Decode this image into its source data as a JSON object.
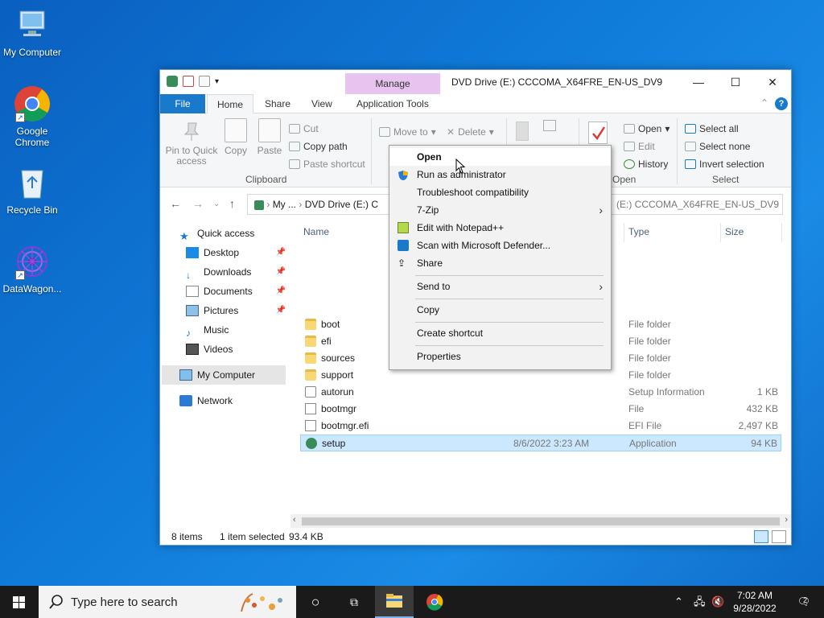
{
  "desktop": {
    "icons": [
      {
        "label": "My Computer"
      },
      {
        "label": "Google Chrome"
      },
      {
        "label": "Recycle Bin"
      },
      {
        "label": "DataWagon..."
      }
    ]
  },
  "window": {
    "manage_tab": "Manage",
    "title": "DVD Drive (E:) CCCOMA_X64FRE_EN-US_DV9",
    "tabs": {
      "file": "File",
      "home": "Home",
      "share": "Share",
      "view": "View",
      "app_tools": "Application Tools"
    },
    "ribbon": {
      "pin_quick_access": "Pin to Quick access",
      "copy": "Copy",
      "paste": "Paste",
      "cut": "Cut",
      "copy_path": "Copy path",
      "paste_shortcut": "Paste shortcut",
      "clipboard_group": "Clipboard",
      "move_to": "Move to",
      "delete": "Delete",
      "open_dropdown": "Open",
      "edit": "Edit",
      "history": "History",
      "open_group": "Open",
      "select_all": "Select all",
      "select_none": "Select none",
      "invert_selection": "Invert selection",
      "select_group": "Select"
    },
    "address": {
      "crumb1": "My ...",
      "crumb2": "DVD Drive (E:) C"
    },
    "search": {
      "text": "(E:) CCCOMA_X64FRE_EN-US_DV9"
    },
    "nav": {
      "quick_access": "Quick access",
      "desktop": "Desktop",
      "downloads": "Downloads",
      "documents": "Documents",
      "pictures": "Pictures",
      "music": "Music",
      "videos": "Videos",
      "my_computer": "My Computer",
      "network": "Network"
    },
    "columns": {
      "name": "Name",
      "type": "Type",
      "size": "Size"
    },
    "files": [
      {
        "name": "boot",
        "date": "",
        "type": "File folder",
        "size": ""
      },
      {
        "name": "efi",
        "date": "",
        "type": "File folder",
        "size": ""
      },
      {
        "name": "sources",
        "date": "",
        "type": "File folder",
        "size": ""
      },
      {
        "name": "support",
        "date": "",
        "type": "File folder",
        "size": ""
      },
      {
        "name": "autorun",
        "date": "",
        "type": "Setup Information",
        "size": "1 KB"
      },
      {
        "name": "bootmgr",
        "date": "",
        "type": "File",
        "size": "432 KB"
      },
      {
        "name": "bootmgr.efi",
        "date": "",
        "type": "EFI File",
        "size": "2,497 KB"
      },
      {
        "name": "setup",
        "date": "8/6/2022 3:23 AM",
        "type": "Application",
        "size": "94 KB"
      }
    ],
    "status": {
      "items": "8 items",
      "selected": "1 item selected",
      "size": "93.4 KB"
    }
  },
  "context_menu": {
    "open": "Open",
    "run_as_admin": "Run as administrator",
    "troubleshoot": "Troubleshoot compatibility",
    "seven_zip": "7-Zip",
    "edit_notepad": "Edit with Notepad++",
    "scan_defender": "Scan with Microsoft Defender...",
    "share": "Share",
    "send_to": "Send to",
    "copy": "Copy",
    "create_shortcut": "Create shortcut",
    "properties": "Properties"
  },
  "taskbar": {
    "search_placeholder": "Type here to search",
    "time": "7:02 AM",
    "date": "9/28/2022",
    "notification_count": "2"
  },
  "colors": {
    "accent": "#1979ca",
    "selection": "#cce8ff",
    "manage_tab": "#e6c4ef"
  }
}
